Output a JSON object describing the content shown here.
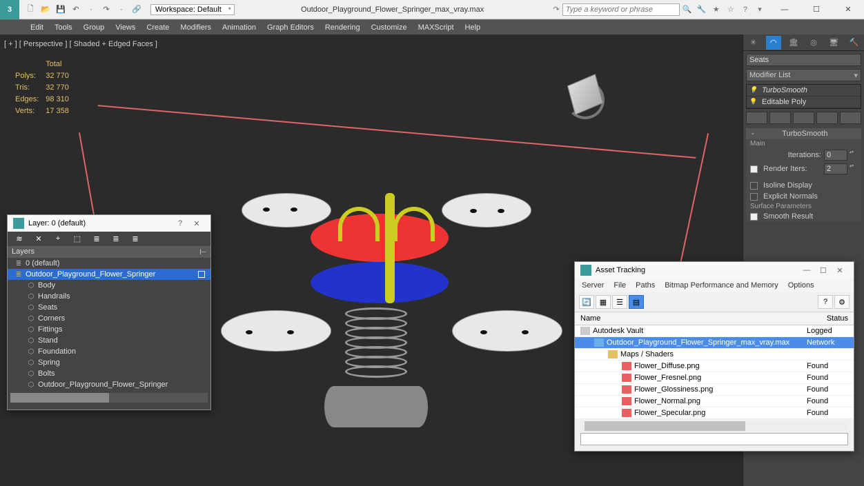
{
  "titlebar": {
    "workspace_label": "Workspace: Default",
    "doc_title": "Outdoor_Playground_Flower_Springer_max_vray.max",
    "search_placeholder": "Type a keyword or phrase"
  },
  "menubar": [
    "Edit",
    "Tools",
    "Group",
    "Views",
    "Create",
    "Modifiers",
    "Animation",
    "Graph Editors",
    "Rendering",
    "Customize",
    "MAXScript",
    "Help"
  ],
  "viewport": {
    "label": "[ + ] [ Perspective ] [ Shaded + Edged Faces ]",
    "stats_head": "Total",
    "stats": [
      {
        "k": "Polys:",
        "v": "32 770"
      },
      {
        "k": "Tris:",
        "v": "32 770"
      },
      {
        "k": "Edges:",
        "v": "98 310"
      },
      {
        "k": "Verts:",
        "v": "17 358"
      }
    ]
  },
  "cmd": {
    "name_field": "Seats",
    "mod_list_label": "Modifier List",
    "stack": [
      "TurboSmooth",
      "Editable Poly"
    ],
    "rollout_title": "TurboSmooth",
    "main_label": "Main",
    "iterations_label": "Iterations:",
    "iterations_val": "0",
    "render_iters_label": "Render Iters:",
    "render_iters_val": "2",
    "isoline_label": "Isoline Display",
    "explicit_label": "Explicit Normals",
    "surface_label": "Surface Parameters",
    "smooth_label": "Smooth Result"
  },
  "layer_dlg": {
    "title": "Layer: 0 (default)",
    "head": "Layers",
    "rows": [
      {
        "label": "0 (default)",
        "depth": 1,
        "sel": false,
        "ico": "≣"
      },
      {
        "label": "Outdoor_Playground_Flower_Springer",
        "depth": 1,
        "sel": true,
        "ico": "≣"
      },
      {
        "label": "Body",
        "depth": 2,
        "sel": false,
        "ico": "⬡"
      },
      {
        "label": "Handrails",
        "depth": 2,
        "sel": false,
        "ico": "⬡"
      },
      {
        "label": "Seats",
        "depth": 2,
        "sel": false,
        "ico": "⬡"
      },
      {
        "label": "Corners",
        "depth": 2,
        "sel": false,
        "ico": "⬡"
      },
      {
        "label": "Fittings",
        "depth": 2,
        "sel": false,
        "ico": "⬡"
      },
      {
        "label": "Stand",
        "depth": 2,
        "sel": false,
        "ico": "⬡"
      },
      {
        "label": "Foundation",
        "depth": 2,
        "sel": false,
        "ico": "⬡"
      },
      {
        "label": "Spring",
        "depth": 2,
        "sel": false,
        "ico": "⬡"
      },
      {
        "label": "Bolts",
        "depth": 2,
        "sel": false,
        "ico": "⬡"
      },
      {
        "label": "Outdoor_Playground_Flower_Springer",
        "depth": 2,
        "sel": false,
        "ico": "⬡"
      }
    ]
  },
  "asset_dlg": {
    "title": "Asset Tracking",
    "menu": [
      "Server",
      "File",
      "Paths",
      "Bitmap Performance and Memory",
      "Options"
    ],
    "col_name": "Name",
    "col_status": "Status",
    "rows": [
      {
        "label": "Autodesk Vault",
        "depth": 0,
        "ico": "i-vault",
        "status": "Logged"
      },
      {
        "label": "Outdoor_Playground_Flower_Springer_max_vray.max",
        "depth": 1,
        "ico": "i-scene",
        "status": "Network",
        "sel": true
      },
      {
        "label": "Maps / Shaders",
        "depth": 2,
        "ico": "i-folder",
        "status": ""
      },
      {
        "label": "Flower_Diffuse.png",
        "depth": 3,
        "ico": "i-png",
        "status": "Found"
      },
      {
        "label": "Flower_Fresnel.png",
        "depth": 3,
        "ico": "i-png",
        "status": "Found"
      },
      {
        "label": "Flower_Glossiness.png",
        "depth": 3,
        "ico": "i-png",
        "status": "Found"
      },
      {
        "label": "Flower_Normal.png",
        "depth": 3,
        "ico": "i-png",
        "status": "Found"
      },
      {
        "label": "Flower_Specular.png",
        "depth": 3,
        "ico": "i-png",
        "status": "Found"
      }
    ]
  }
}
